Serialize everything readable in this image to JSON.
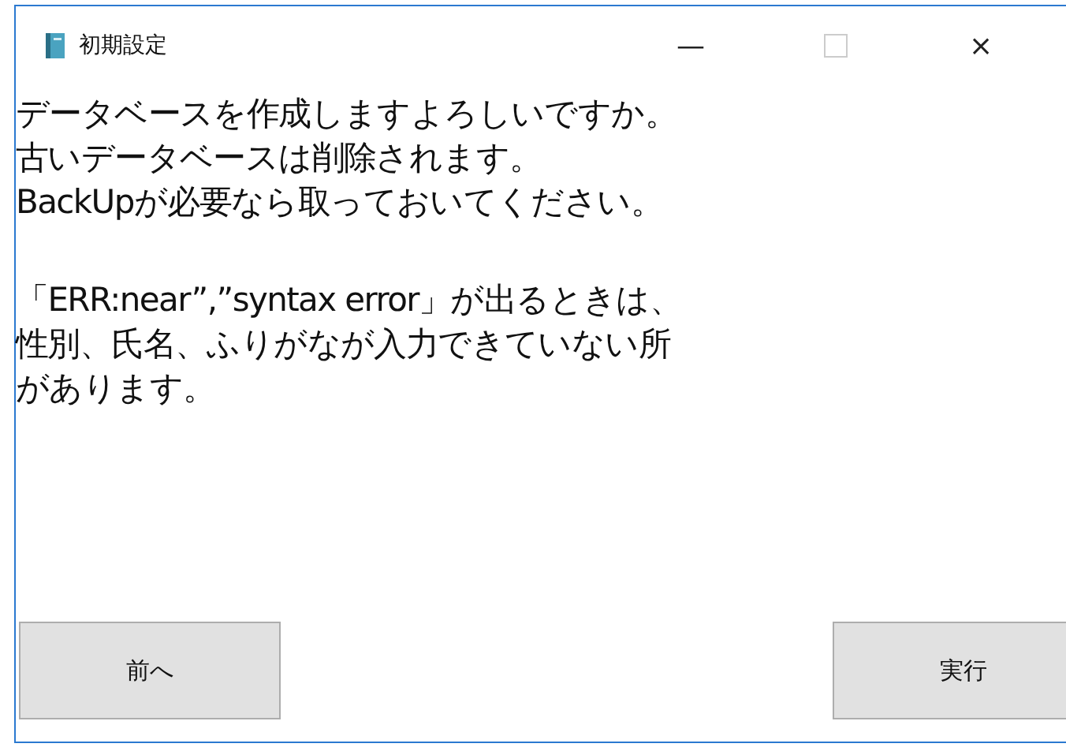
{
  "window": {
    "title": "初期設定",
    "controls": [
      "—",
      "×"
    ]
  },
  "message": {
    "paragraphs": [
      [
        "データベースを作成しますよろしいですか。",
        "古いデータベースは削除されます。",
        "BackUpが必要なら取っておいてください。"
      ],
      [
        "「ERR:near”,”syntax error」が出るときは、",
        "性別、氏名、ふりがなが入力できていない所",
        "があります。"
      ]
    ]
  },
  "buttons": [
    {
      "label": "前へ",
      "kind": "back"
    },
    {
      "label": "実行",
      "kind": "run"
    }
  ]
}
